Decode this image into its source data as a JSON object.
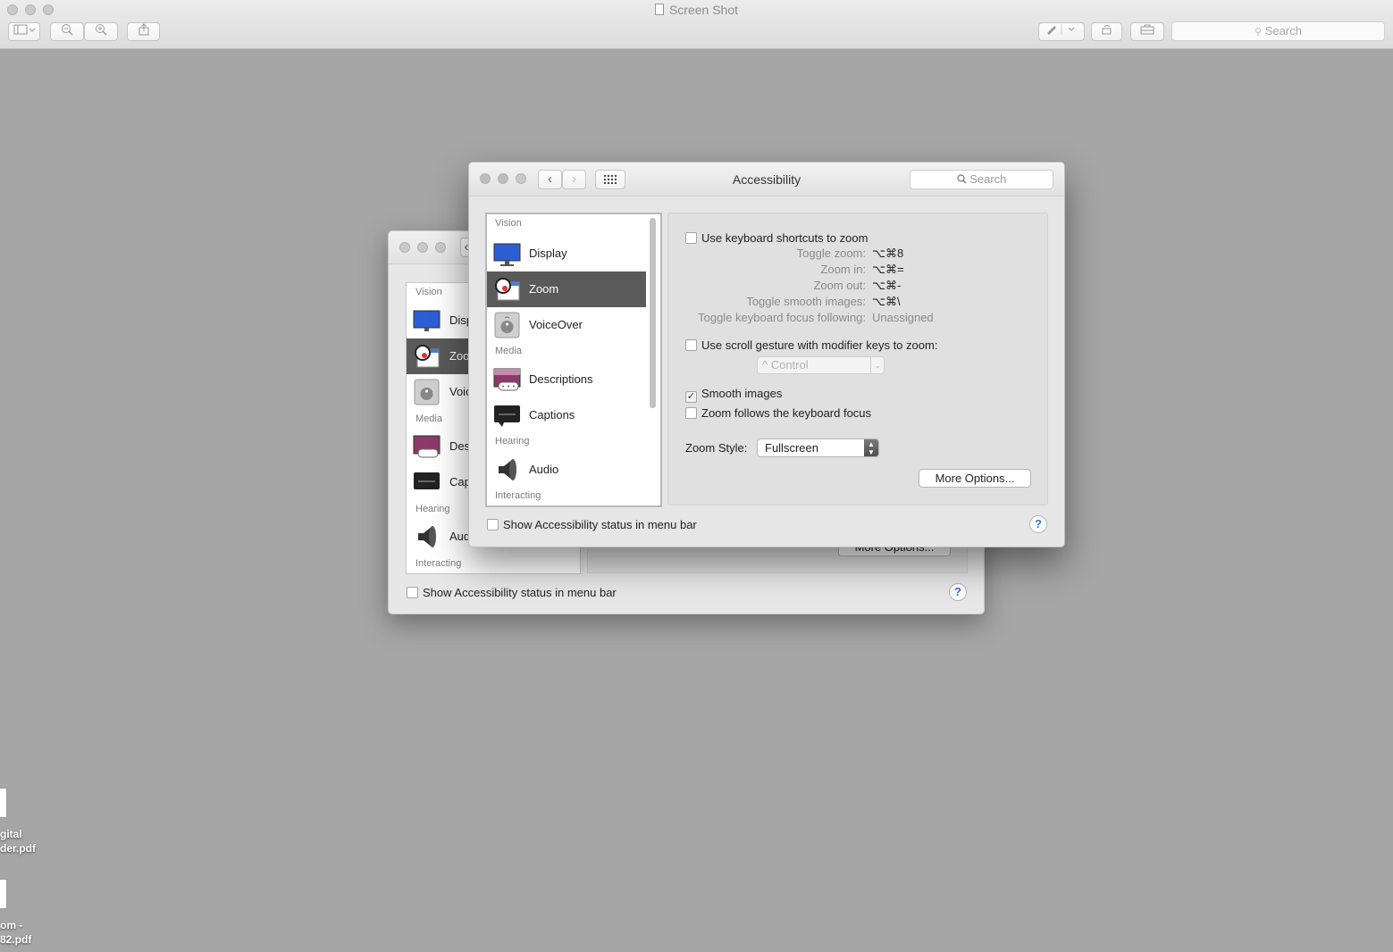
{
  "preview": {
    "title": "Screen Shot",
    "search_placeholder": "Search",
    "toolbar": {
      "sidebar_icon": "sidebar-icon",
      "zoom_out_icon": "zoom-out-icon",
      "zoom_in_icon": "zoom-in-icon",
      "share_icon": "share-icon",
      "markup_icon": "pen-icon",
      "rotate_icon": "rotate-icon",
      "toolbox_icon": "toolbox-icon"
    }
  },
  "back_window": {
    "sidebar": {
      "sections": [
        "Vision",
        "Media",
        "Hearing",
        "Interacting"
      ],
      "items": [
        "Disp",
        "Zoo",
        "Voic",
        "Des",
        "Cap",
        "Aud"
      ]
    },
    "more_options_label": "More Options...",
    "status_checkbox_label": "Show Accessibility status in menu bar",
    "help_label": "?"
  },
  "front_window": {
    "title": "Accessibility",
    "search_placeholder": "Search",
    "sidebar": {
      "section_vision": "Vision",
      "section_media": "Media",
      "section_hearing": "Hearing",
      "section_interacting": "Interacting",
      "item_display": "Display",
      "item_zoom": "Zoom",
      "item_voiceover": "VoiceOver",
      "item_descriptions": "Descriptions",
      "item_captions": "Captions",
      "item_audio": "Audio",
      "selected": "Zoom"
    },
    "zoom": {
      "use_keyboard_shortcuts_label": "Use keyboard shortcuts to zoom",
      "use_keyboard_shortcuts_checked": false,
      "shortcuts": [
        {
          "key": "Toggle zoom:",
          "value": "⌥⌘8"
        },
        {
          "key": "Zoom in:",
          "value": "⌥⌘="
        },
        {
          "key": "Zoom out:",
          "value": "⌥⌘-"
        },
        {
          "key": "Toggle smooth images:",
          "value": "⌥⌘\\"
        },
        {
          "key": "Toggle keyboard focus following:",
          "value": "Unassigned"
        }
      ],
      "scroll_gesture_label": "Use scroll gesture with modifier keys to zoom:",
      "scroll_gesture_checked": false,
      "modifier_key_value": "^ Control",
      "smooth_images_label": "Smooth images",
      "smooth_images_checked": true,
      "follow_focus_label": "Zoom follows the keyboard focus",
      "follow_focus_checked": false,
      "zoom_style_label": "Zoom Style:",
      "zoom_style_value": "Fullscreen",
      "more_options_label": "More Options..."
    },
    "status_checkbox_label": "Show Accessibility status in menu bar",
    "status_checkbox_checked": false,
    "help_label": "?"
  },
  "desktop": {
    "file1_label_line1": "gital",
    "file1_label_line2": "der.pdf",
    "file2_label_line1": "om -",
    "file2_label_line2": "82.pdf"
  },
  "colors": {
    "desktop_bg": "#a6a6a6",
    "selection_bg": "#5a5a5a",
    "help_blue": "#2a74dc"
  }
}
